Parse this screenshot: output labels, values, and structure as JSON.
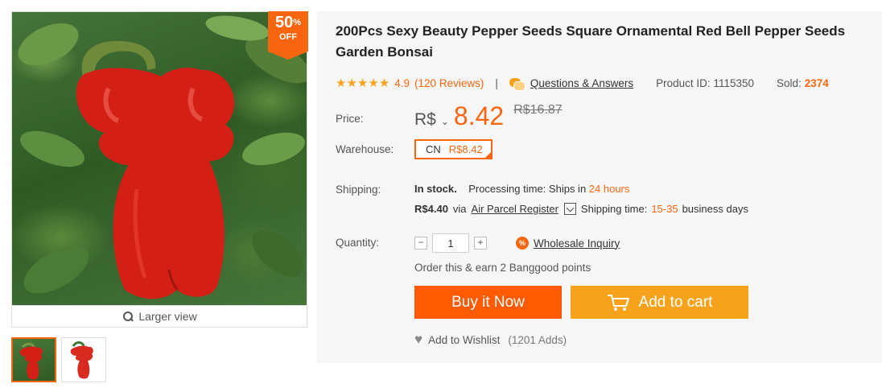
{
  "gallery": {
    "badge": {
      "percent": "50",
      "percent_sign": "%",
      "off": "OFF"
    },
    "larger_view": "Larger view",
    "thumbnails": 2
  },
  "product": {
    "title": "200Pcs Sexy Beauty Pepper Seeds Square Ornamental Red Bell Pepper Seeds Garden Bonsai",
    "rating_stars": 4.9,
    "rating": "4.9",
    "reviews": "(120 Reviews)",
    "separator": "|",
    "qa_link": "Questions & Answers",
    "product_id": "Product ID: 1115350",
    "sold_label": "Sold:",
    "sold_value": "2374"
  },
  "price": {
    "label": "Price:",
    "currency": "R$",
    "caret": "⌄",
    "value": "8.42",
    "old": "R$16.87"
  },
  "warehouse": {
    "label": "Warehouse:",
    "code": "CN",
    "price": "R$8.42"
  },
  "shipping": {
    "label": "Shipping:",
    "stock": "In stock.",
    "processing_label": "Processing time:",
    "processing_prefix": "Ships in",
    "processing_value": "24 hours",
    "cost": "R$4.40",
    "via": "via",
    "method": "Air Parcel Register",
    "time_label": "Shipping time:",
    "time_value": "15-35",
    "time_suffix": "business days"
  },
  "quantity": {
    "label": "Quantity:",
    "minus": "−",
    "value": "1",
    "plus": "+",
    "wholesale_icon": "%",
    "wholesale": "Wholesale Inquiry"
  },
  "points": "Order this & earn 2 Banggood points",
  "actions": {
    "buy": "Buy it Now",
    "cart": "Add to cart"
  },
  "wishlist": {
    "label": "Add to Wishlist",
    "count": "(1201 Adds)"
  },
  "colors": {
    "accent": "#f7660f",
    "buy_button": "#ff5a00",
    "cart_button": "#f7a21b",
    "star": "#f7a21b"
  }
}
